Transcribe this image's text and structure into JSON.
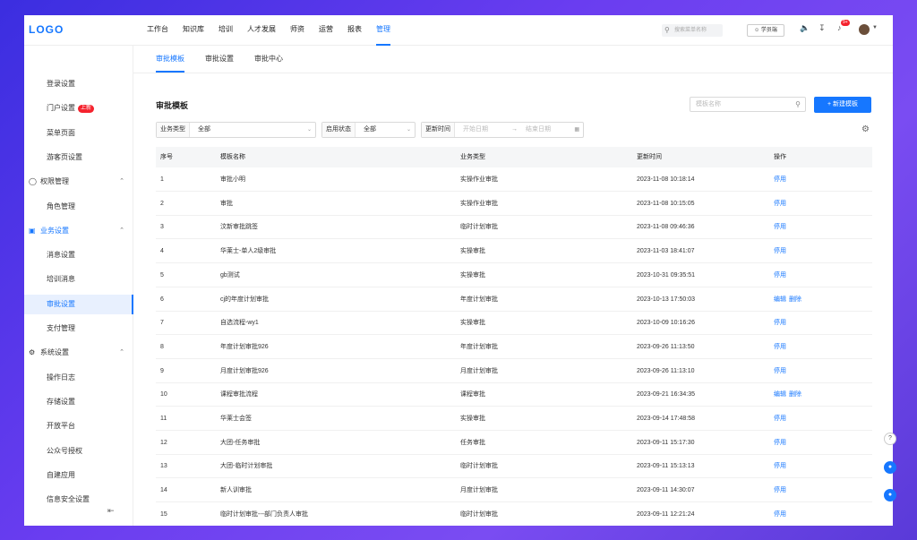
{
  "topbar": {
    "logo": "LOGO",
    "nav": [
      "工作台",
      "知识库",
      "培训",
      "人才发展",
      "师资",
      "运营",
      "报表",
      "管理"
    ],
    "search_placeholder": "搜索菜单名称",
    "role_label": "学员端",
    "notif_count": "9+"
  },
  "sidebar": {
    "items": [
      {
        "label": "登录设置",
        "kind": "sub"
      },
      {
        "label": "门户设置",
        "kind": "sub",
        "tag": "上新"
      },
      {
        "label": "菜单页面",
        "kind": "sub"
      },
      {
        "label": "游客页设置",
        "kind": "sub"
      },
      {
        "label": "权限管理",
        "kind": "group"
      },
      {
        "label": "角色管理",
        "kind": "sub"
      },
      {
        "label": "业务设置",
        "kind": "group"
      },
      {
        "label": "消息设置",
        "kind": "sub"
      },
      {
        "label": "培训消息",
        "kind": "sub"
      },
      {
        "label": "审批设置",
        "kind": "sub"
      },
      {
        "label": "支付管理",
        "kind": "sub"
      },
      {
        "label": "系统设置",
        "kind": "group"
      },
      {
        "label": "操作日志",
        "kind": "sub"
      },
      {
        "label": "存储设置",
        "kind": "sub"
      },
      {
        "label": "开放平台",
        "kind": "sub"
      },
      {
        "label": "公众号授权",
        "kind": "sub"
      },
      {
        "label": "自建应用",
        "kind": "sub"
      },
      {
        "label": "信息安全设置",
        "kind": "sub"
      }
    ]
  },
  "main": {
    "tabs": [
      "审批模板",
      "审批设置",
      "审批中心"
    ],
    "title": "审批模板",
    "search_placeholder": "模板名称",
    "new_button": "+ 新建模板",
    "filters": {
      "type_label": "业务类型",
      "type_value": "全部",
      "status_label": "启用状态",
      "status_value": "全部",
      "time_label": "更新时间",
      "start_placeholder": "开始日期",
      "end_placeholder": "结束日期",
      "range_arrow": "→"
    },
    "columns": [
      "序号",
      "模板名称",
      "业务类型",
      "更新时间",
      "操作"
    ],
    "rows": [
      {
        "no": "1",
        "name": "审批小明",
        "type": "实操作业审批",
        "time": "2023-11-08 10:18:14",
        "ops": [
          "停用"
        ]
      },
      {
        "no": "2",
        "name": "审批",
        "type": "实操作业审批",
        "time": "2023-11-08 10:15:05",
        "ops": [
          "停用"
        ]
      },
      {
        "no": "3",
        "name": "汶新审批跳签",
        "type": "临时计划审批",
        "time": "2023-11-08 09:46:36",
        "ops": [
          "停用"
        ]
      },
      {
        "no": "4",
        "name": "华莱士-单人2级审批",
        "type": "实操审批",
        "time": "2023-11-03 18:41:07",
        "ops": [
          "停用"
        ]
      },
      {
        "no": "5",
        "name": "gb测试",
        "type": "实操审批",
        "time": "2023-10-31 09:35:51",
        "ops": [
          "停用"
        ]
      },
      {
        "no": "6",
        "name": "cj的年度计划审批",
        "type": "年度计划审批",
        "time": "2023-10-13 17:50:03",
        "ops": [
          "编辑",
          "删除"
        ]
      },
      {
        "no": "7",
        "name": "自选流程-wy1",
        "type": "实操审批",
        "time": "2023-10-09 10:16:26",
        "ops": [
          "停用"
        ]
      },
      {
        "no": "8",
        "name": "年度计划审批926",
        "type": "年度计划审批",
        "time": "2023-09-26 11:13:50",
        "ops": [
          "停用"
        ]
      },
      {
        "no": "9",
        "name": "月度计划审批926",
        "type": "月度计划审批",
        "time": "2023-09-26 11:13:10",
        "ops": [
          "停用"
        ]
      },
      {
        "no": "10",
        "name": "课程审批流程",
        "type": "课程审批",
        "time": "2023-09-21 16:34:35",
        "ops": [
          "编辑",
          "删除"
        ]
      },
      {
        "no": "11",
        "name": "华莱士会签",
        "type": "实操审批",
        "time": "2023-09-14 17:48:58",
        "ops": [
          "停用"
        ]
      },
      {
        "no": "12",
        "name": "大团-任务审批",
        "type": "任务审批",
        "time": "2023-09-11 15:17:30",
        "ops": [
          "停用"
        ]
      },
      {
        "no": "13",
        "name": "大团-临时计划审批",
        "type": "临时计划审批",
        "time": "2023-09-11 15:13:13",
        "ops": [
          "停用"
        ]
      },
      {
        "no": "14",
        "name": "新人训审批",
        "type": "月度计划审批",
        "time": "2023-09-11 14:30:07",
        "ops": [
          "停用"
        ]
      },
      {
        "no": "15",
        "name": "临时计划审批---部门负责人审批",
        "type": "临时计划审批",
        "time": "2023-09-11 12:21:24",
        "ops": [
          "停用"
        ]
      }
    ]
  }
}
